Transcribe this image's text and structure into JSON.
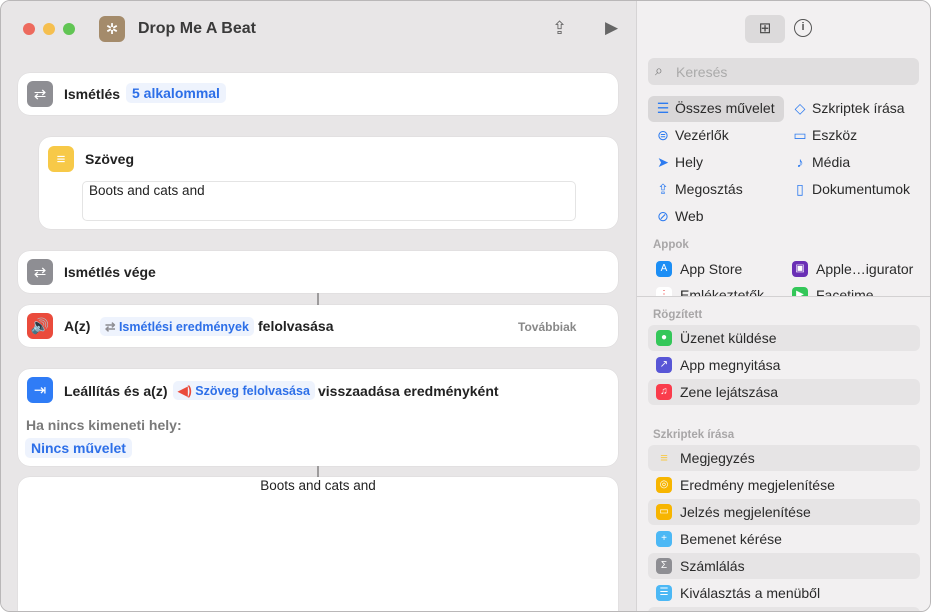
{
  "window": {
    "title": "Drop Me A Beat"
  },
  "editor": {
    "repeat": {
      "label": "Ismétlés",
      "count": "5 alkalommal"
    },
    "text_action": {
      "label": "Szöveg",
      "value": "Boots and cats and"
    },
    "repeat_end": {
      "label": "Ismétlés vége"
    },
    "speak": {
      "prefix": "A(z)",
      "variable": "Ismétlési eredmények",
      "suffix": "felolvasása",
      "more": "Továbbiak"
    },
    "stop": {
      "prefix": "Leállítás és a(z)",
      "variable": "Szöveg felolvasása",
      "suffix": "visszaadása eredményként",
      "no_output_label": "Ha nincs kimeneti hely:",
      "no_output_value": "Nincs művelet"
    },
    "result": {
      "text": "Boots and cats and"
    }
  },
  "sidebar": {
    "search_placeholder": "Keresés",
    "categories": [
      {
        "label": "Összes művelet",
        "icon": "list-icon"
      },
      {
        "label": "Szkriptek írása",
        "icon": "scripting-icon"
      },
      {
        "label": "Vezérlők",
        "icon": "toggles-icon"
      },
      {
        "label": "Eszköz",
        "icon": "display-icon"
      },
      {
        "label": "Hely",
        "icon": "location-icon"
      },
      {
        "label": "Média",
        "icon": "music-note-icon"
      },
      {
        "label": "Megosztás",
        "icon": "share-icon"
      },
      {
        "label": "Dokumentumok",
        "icon": "document-icon"
      },
      {
        "label": "Web",
        "icon": "compass-icon"
      }
    ],
    "apps_header": "Appok",
    "apps": [
      {
        "label": "App Store"
      },
      {
        "label": "Apple…igurator"
      },
      {
        "label": "Emlékeztetők"
      },
      {
        "label": "Facetime"
      }
    ],
    "pinned_header": "Rögzített",
    "pinned": [
      {
        "label": "Üzenet küldése",
        "color": "#34c759"
      },
      {
        "label": "App megnyitása",
        "color": "#5856d6"
      },
      {
        "label": "Zene lejátszása",
        "color": "#fa3c4c"
      }
    ],
    "scripting_header": "Szkriptek írása",
    "scripting": [
      {
        "label": "Megjegyzés",
        "color": "#f7c948"
      },
      {
        "label": "Eredmény megjelenítése",
        "color": "#f7b500"
      },
      {
        "label": "Jelzés megjelenítése",
        "color": "#f7b500"
      },
      {
        "label": "Bemenet kérése",
        "color": "#4cb8f5"
      },
      {
        "label": "Számlálás",
        "color": "#8e8e93"
      },
      {
        "label": "Kiválasztás a menüből",
        "color": "#4cb8f5"
      }
    ]
  }
}
